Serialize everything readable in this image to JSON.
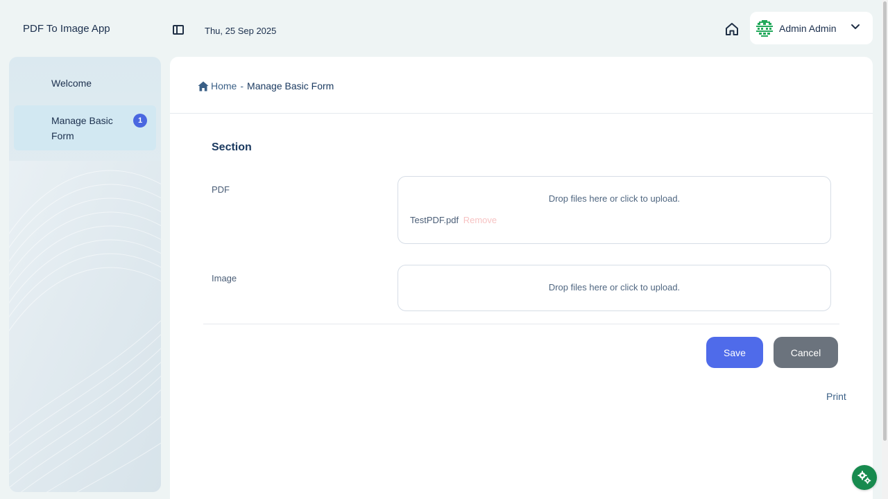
{
  "app": {
    "title": "PDF To Image App"
  },
  "topbar": {
    "date": "Thu, 25 Sep 2025",
    "user_name": "Admin Admin"
  },
  "sidebar": {
    "items": [
      {
        "label": "Welcome"
      },
      {
        "label": "Manage Basic Form",
        "badge": "1",
        "active": true
      }
    ]
  },
  "breadcrumb": {
    "home": "Home",
    "separator": "-",
    "current": "Manage Basic Form"
  },
  "form": {
    "section_title": "Section",
    "fields": [
      {
        "label": "PDF",
        "dropzone_text": "Drop files here or click to upload.",
        "file_name": "TestPDF.pdf",
        "remove_label": "Remove"
      },
      {
        "label": "Image",
        "dropzone_text": "Drop files here or click to upload."
      }
    ],
    "save_label": "Save",
    "cancel_label": "Cancel",
    "print_label": "Print"
  },
  "colors": {
    "accent": "#4f6bea",
    "badge": "#4a67e0",
    "cancel": "#6b737d",
    "fab": "#178a4e",
    "remove": "#f7c3c3"
  },
  "icons": {
    "sidebar_toggle": "sidebar-toggle-icon",
    "home": "home-icon",
    "avatar": "avatar-icon",
    "chevron": "chevron-down-icon",
    "settings": "gears-icon"
  }
}
